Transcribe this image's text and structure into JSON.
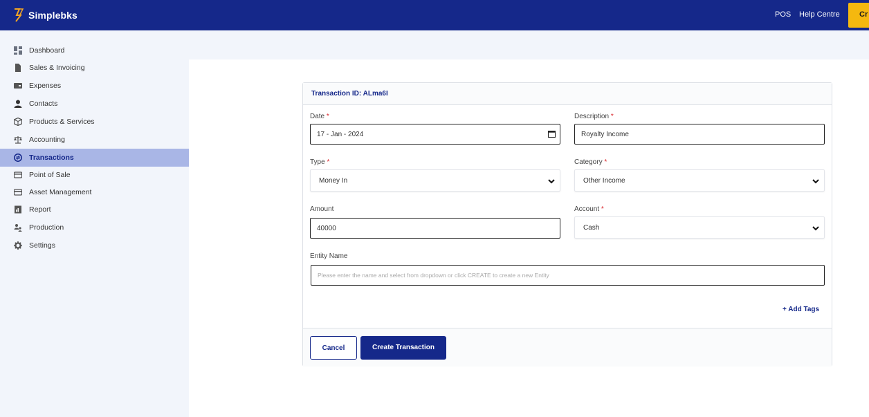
{
  "app": {
    "name": "Simplebks"
  },
  "topnav": {
    "pos": "POS",
    "help": "Help Centre",
    "create": "Cr"
  },
  "sidebar": {
    "items": [
      {
        "label": "Dashboard",
        "icon": "dashboard-icon"
      },
      {
        "label": "Sales & Invoicing",
        "icon": "document-icon"
      },
      {
        "label": "Expenses",
        "icon": "wallet-icon"
      },
      {
        "label": "Contacts",
        "icon": "user-icon"
      },
      {
        "label": "Products & Services",
        "icon": "box-icon"
      },
      {
        "label": "Accounting",
        "icon": "scale-icon"
      },
      {
        "label": "Transactions",
        "icon": "transaction-icon",
        "active": true
      },
      {
        "label": "Point of Sale",
        "icon": "card-icon"
      },
      {
        "label": "Asset Management",
        "icon": "card-icon"
      },
      {
        "label": "Report",
        "icon": "report-icon"
      },
      {
        "label": "Production",
        "icon": "people-icon"
      },
      {
        "label": "Settings",
        "icon": "gear-icon"
      }
    ]
  },
  "form": {
    "header": "Transaction ID: ALma6I",
    "date": {
      "label": "Date",
      "value": "17 - Jan - 2024"
    },
    "description": {
      "label": "Description",
      "value": "Royalty Income"
    },
    "type": {
      "label": "Type",
      "value": "Money In"
    },
    "category": {
      "label": "Category",
      "value": "Other Income"
    },
    "amount": {
      "label": "Amount",
      "value": "40000"
    },
    "account": {
      "label": "Account",
      "value": "Cash"
    },
    "entity": {
      "label": "Entity Name",
      "placeholder": "Please enter the name and select from dropdown or click CREATE to create a new Entity"
    },
    "required_mark": "*",
    "add_tags": "+ Add Tags",
    "cancel": "Cancel",
    "submit": "Create Transaction"
  },
  "colors": {
    "primary": "#15288a",
    "accent": "#f5b80f",
    "active_bg": "#a9b6e6",
    "required": "#d9252a"
  }
}
